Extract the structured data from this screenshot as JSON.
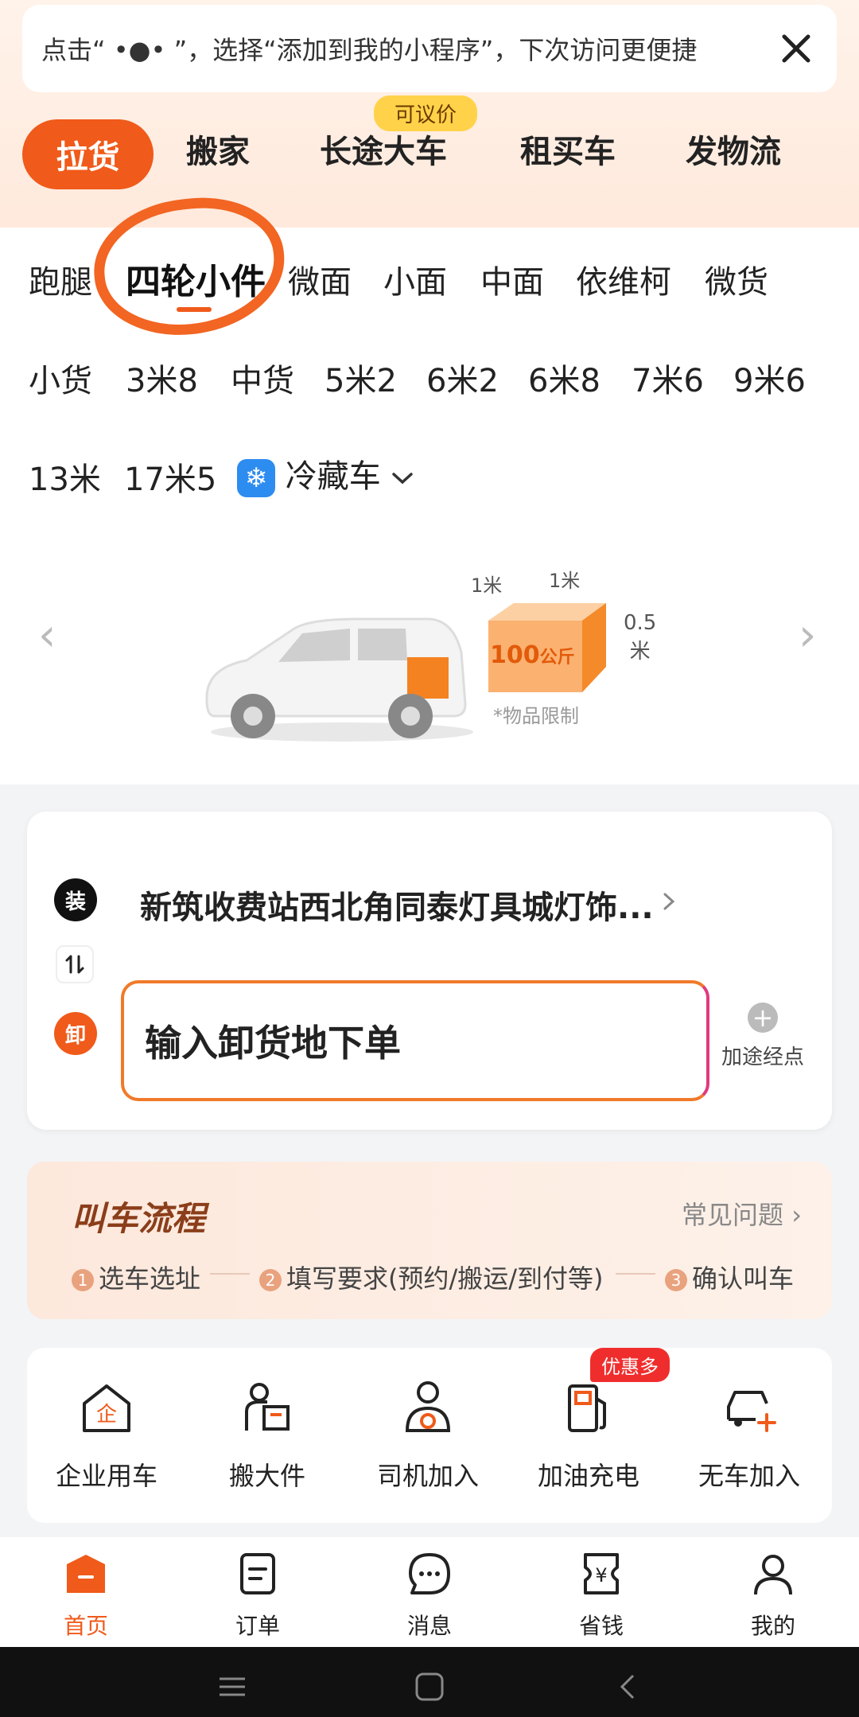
{
  "tip": {
    "text": "点击“ •●• ”，选择“添加到我的小程序”，下次访问更便捷"
  },
  "categories": {
    "items": [
      "拉货",
      "搬家",
      "长途大车",
      "租买车",
      "发物流"
    ],
    "badge": "可议价"
  },
  "vehicle_types": {
    "row1": [
      "跑腿",
      "四轮小件",
      "微面",
      "小面",
      "中面",
      "依维柯",
      "微货"
    ],
    "row2": [
      "小货",
      "3米8",
      "中货",
      "5米2",
      "6米2",
      "6米8",
      "7米6",
      "9米6"
    ],
    "row3": [
      "13米",
      "17米5",
      "冷藏车"
    ],
    "selected": "四轮小件"
  },
  "vehicle_info": {
    "dim_length": "1米",
    "dim_width": "1米",
    "dim_height_value": "0.5",
    "dim_height_unit": "米",
    "weight_value": "100",
    "weight_unit": "公斤",
    "limit_note": "*物品限制"
  },
  "order": {
    "load_badge": "装",
    "load_address": "新筑收费站西北角同泰灯具城灯饰...",
    "unload_badge": "卸",
    "unload_placeholder": "输入卸货地下单",
    "waypoint_label": "加途经点"
  },
  "process": {
    "title": "叫车流程",
    "faq": "常见问题",
    "steps": [
      {
        "num": "1",
        "label": "选车选址"
      },
      {
        "num": "2",
        "label": "填写要求(预约/搬运/到付等)"
      },
      {
        "num": "3",
        "label": "确认叫车"
      }
    ]
  },
  "services": {
    "items": [
      "企业用车",
      "搬大件",
      "司机加入",
      "加油充电",
      "无车加入"
    ],
    "promo": "优惠多"
  },
  "tabbar": {
    "items": [
      "首页",
      "订单",
      "消息",
      "省钱",
      "我的"
    ],
    "active": "首页"
  },
  "colors": {
    "accent": "#f05a1a",
    "annotation": "#f26522"
  }
}
